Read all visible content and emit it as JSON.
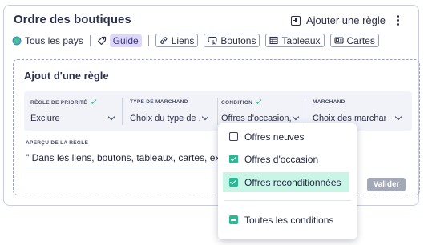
{
  "header": {
    "title": "Ordre des boutiques",
    "add_rule_label": "Ajouter une règle"
  },
  "filters": {
    "all_countries": "Tous les pays",
    "guide": "Guide",
    "links": "Liens",
    "buttons": "Boutons",
    "tables": "Tableaux",
    "cards": "Cartes"
  },
  "rule_form": {
    "title": "Ajout d'une règle",
    "fields": [
      {
        "label": "RÈGLE DE PRIORITÉ",
        "value": "Exclure",
        "checked": true
      },
      {
        "label": "TYPE DE MARCHAND",
        "value": "Choix du type de ...",
        "checked": false
      },
      {
        "label": "CONDITION",
        "value": "Offres d'occasion,...",
        "checked": true
      },
      {
        "label": "MARCHAND",
        "value": "Choix des marchan...",
        "checked": false
      }
    ],
    "preview_label": "APERÇU DE LA RÈGLE",
    "preview_text": "\" Dans les liens, boutons, tableaux, cartes, exclu",
    "submit_label": "Valider"
  },
  "condition_dropdown": {
    "options": [
      {
        "label": "Offres neuves",
        "state": "unchecked"
      },
      {
        "label": "Offres d'occasion",
        "state": "checked"
      },
      {
        "label": "Offres reconditionnées",
        "state": "checked",
        "highlighted": true
      }
    ],
    "all_label": "Toutes les conditions",
    "all_state": "indeterminate"
  },
  "colors": {
    "accent_green": "#2bb895",
    "highlight": "#c8f5e6",
    "guide_bg": "#dcd7fb",
    "disabled_button": "#a4a9b8"
  }
}
